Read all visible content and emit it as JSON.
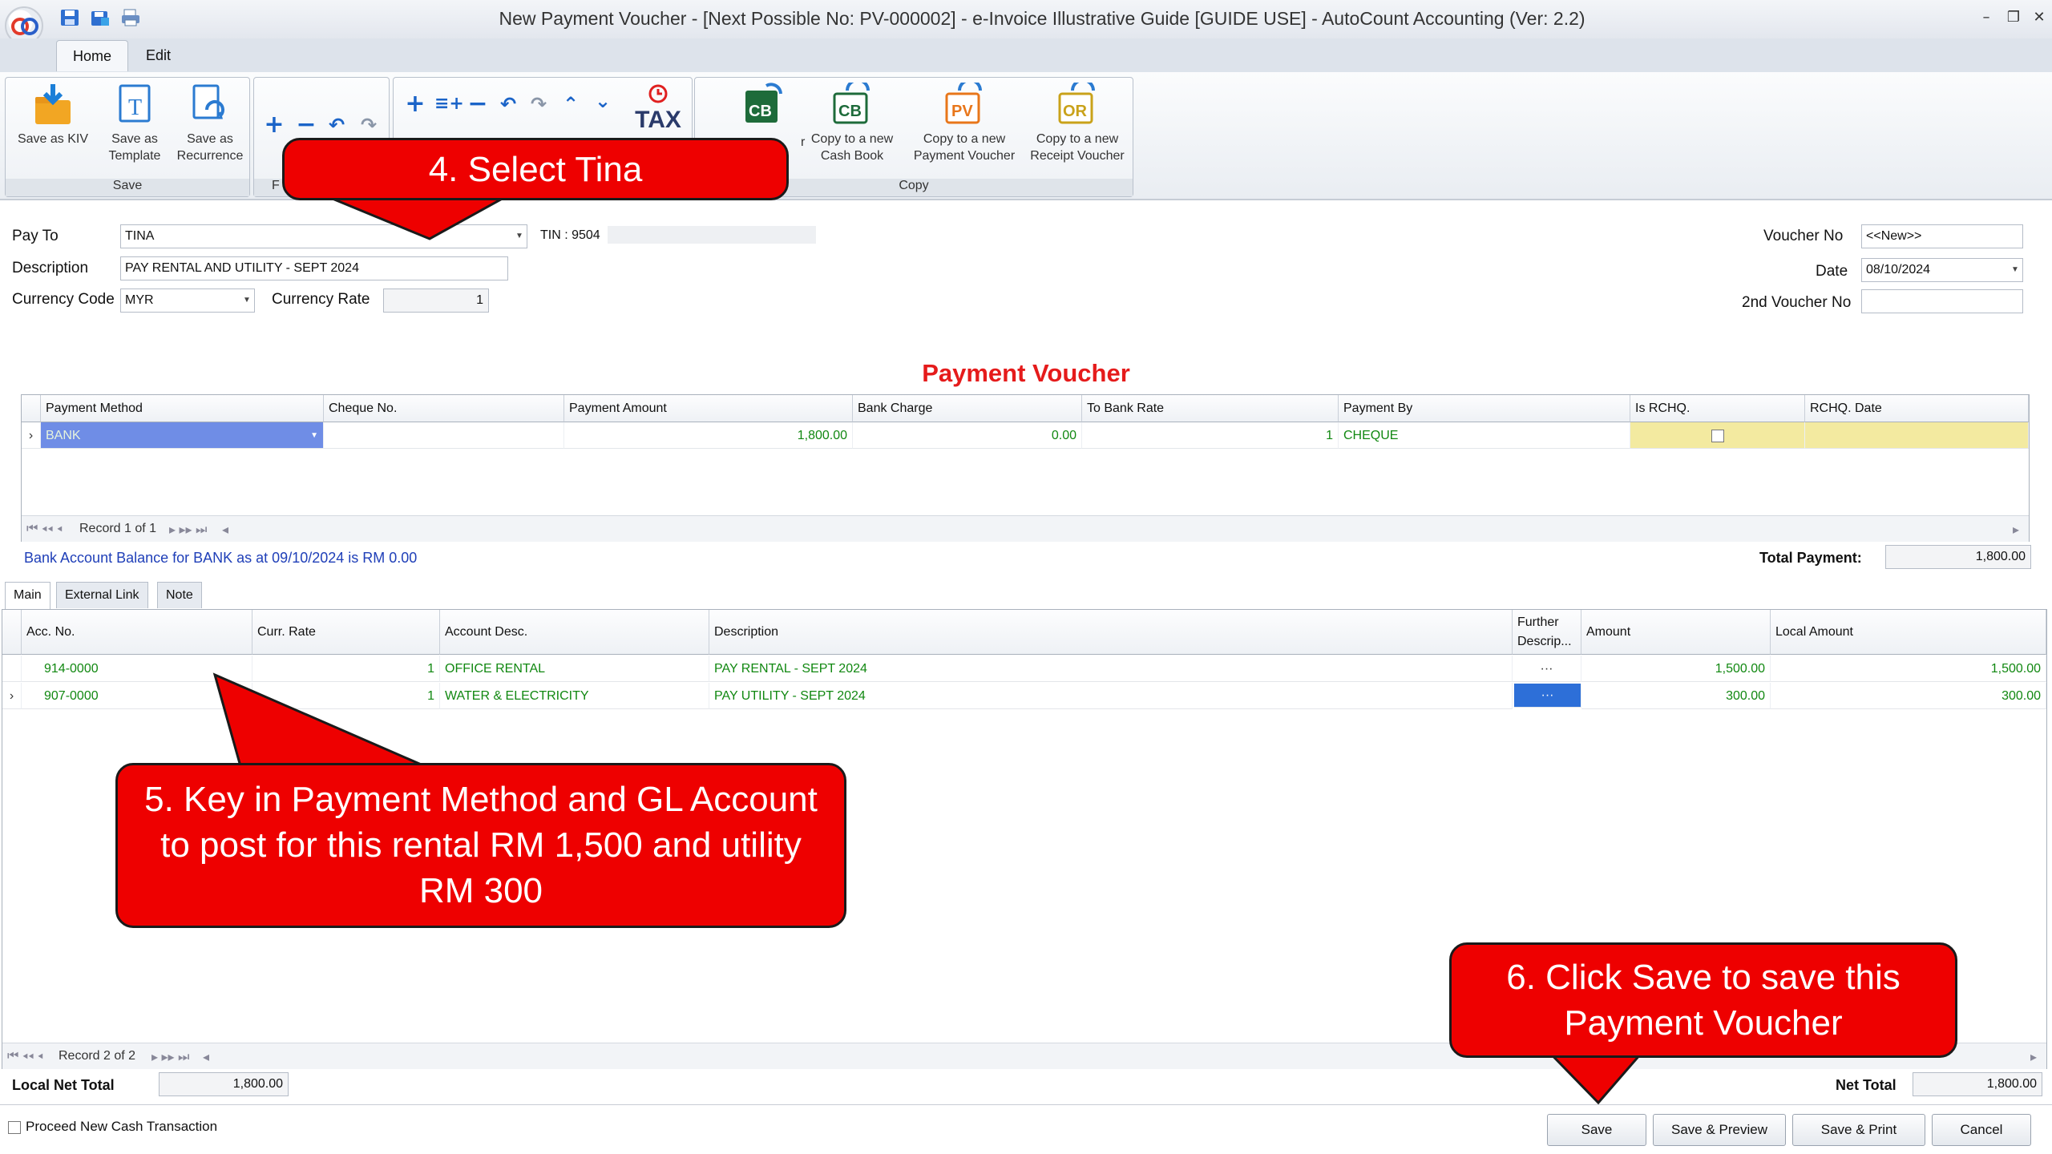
{
  "window": {
    "title": "New Payment Voucher - [Next Possible No: PV-000002] - e-Invoice Illustrative Guide [GUIDE USE] - AutoCount Accounting (Ver: 2.2)",
    "controls": [
      "–",
      "❐",
      "✕"
    ]
  },
  "ribbon": {
    "tabs": [
      "Home",
      "Edit"
    ],
    "save_group": {
      "label": "Save",
      "buttons": [
        "Save as KIV",
        "Save as Template",
        "Save as Recurrence"
      ]
    },
    "group2_label": "F",
    "copy_group": {
      "label": "Copy",
      "buttons": [
        "Copy to a new Cash Book",
        "Copy to a new Payment Voucher",
        "Copy to a new Receipt Voucher"
      ],
      "partial_label": "r"
    },
    "tax_label": "TAX",
    "icons": [
      "save-icon",
      "print-icon",
      "add-icon",
      "remove-icon",
      "undo-icon",
      "redo-icon",
      "move-up-icon",
      "move-down-icon",
      "tax-icon"
    ]
  },
  "header": {
    "pay_to_label": "Pay To",
    "pay_to_value": "TINA",
    "tin_label": "TIN : 9504",
    "description_label": "Description",
    "description_value": "PAY RENTAL AND UTILITY - SEPT 2024",
    "currency_code_label": "Currency Code",
    "currency_code_value": "MYR",
    "currency_rate_label": "Currency Rate",
    "currency_rate_value": "1",
    "voucher_no_label": "Voucher No",
    "voucher_no_value": "<<New>>",
    "date_label": "Date",
    "date_value": "08/10/2024",
    "second_voucher_label": "2nd Voucher No",
    "second_voucher_value": ""
  },
  "heading": "Payment Voucher",
  "payment_grid": {
    "columns": [
      "Payment Method",
      "Cheque No.",
      "Payment Amount",
      "Bank Charge",
      "To Bank Rate",
      "Payment By",
      "Is RCHQ.",
      "RCHQ. Date"
    ],
    "row": {
      "method": "BANK",
      "cheque": "",
      "amount": "1,800.00",
      "bank_charge": "0.00",
      "rate": "1",
      "by": "CHEQUE",
      "rchq_date": ""
    },
    "record_text": "Record 1 of 1"
  },
  "bank_balance_text": "Bank Account Balance for BANK as at 09/10/2024 is RM 0.00",
  "total_payment_label": "Total Payment:",
  "total_payment_value": "1,800.00",
  "detail_tabs": [
    "Main",
    "External Link",
    "Note"
  ],
  "detail_grid": {
    "columns": [
      "Acc. No.",
      "Curr. Rate",
      "Account Desc.",
      "Description",
      "Further Descrip...",
      "Amount",
      "Local Amount"
    ],
    "rows": [
      {
        "acc": "914-0000",
        "rate": "1",
        "acc_desc": "OFFICE RENTAL",
        "desc": "PAY RENTAL - SEPT 2024",
        "further": "···",
        "amount": "1,500.00",
        "local": "1,500.00"
      },
      {
        "acc": "907-0000",
        "rate": "1",
        "acc_desc": "WATER & ELECTRICITY",
        "desc": "PAY UTILITY - SEPT 2024",
        "further": "···",
        "amount": "300.00",
        "local": "300.00"
      }
    ],
    "record_text": "Record 2 of 2"
  },
  "footer": {
    "local_net_total_label": "Local Net Total",
    "local_net_total_value": "1,800.00",
    "net_total_label": "Net Total",
    "net_total_value": "1,800.00",
    "proceed_label": "Proceed New Cash Transaction",
    "buttons": [
      "Save",
      "Save & Preview",
      "Save & Print",
      "Cancel"
    ]
  },
  "callouts": {
    "step4": "4. Select Tina",
    "step5": [
      "5. Key in Payment Method and GL Account",
      "to post for this rental RM 1,500 and utility",
      "RM 300"
    ],
    "step6": [
      "6. Click Save to save this",
      "Payment Voucher"
    ]
  },
  "colors": {
    "callout_red": "#ee0000",
    "heading_red": "#e51b1b",
    "row_green": "#118811",
    "selection_blue": "#6f8de6",
    "rchq_yellow": "#f3eaa0",
    "link_blue": "#1f3fb8"
  }
}
